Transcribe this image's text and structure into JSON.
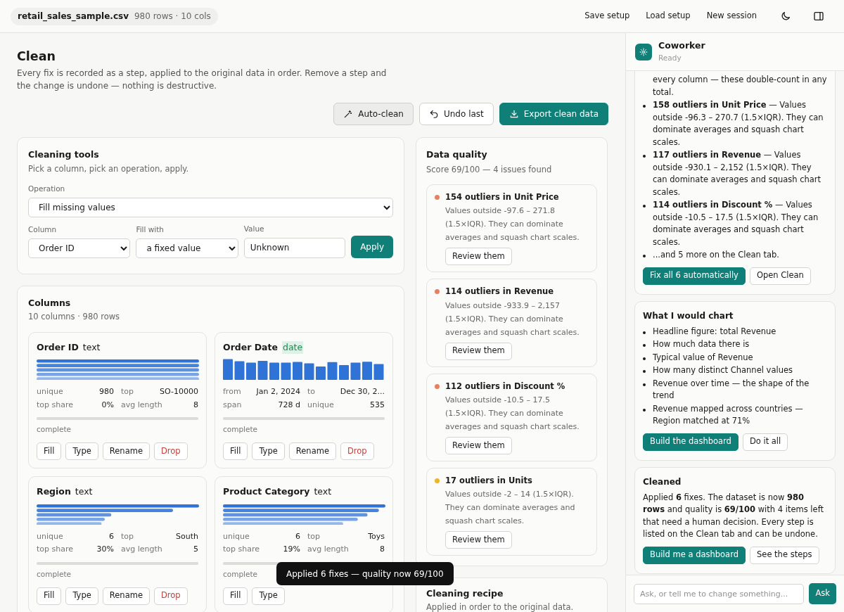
{
  "topbar": {
    "file_name": "retail_sales_sample.csv",
    "file_meta": "980 rows · 10 cols",
    "actions": [
      "Save setup",
      "Load setup",
      "New session"
    ]
  },
  "page": {
    "title": "Clean",
    "description": "Every fix is recorded as a step, applied to the original data in order. Remove a step and the change is undone — nothing is destructive.",
    "actions": [
      {
        "label": "Auto-clean",
        "kind": "auto"
      },
      {
        "label": "Undo last",
        "kind": "undo"
      },
      {
        "label": "Export clean data",
        "kind": "export"
      }
    ]
  },
  "cleaning_tools": {
    "title": "Cleaning tools",
    "subtitle": "Pick a column, pick an operation, apply.",
    "operation": {
      "label": "Operation",
      "value": "Fill missing values"
    },
    "column": {
      "label": "Column",
      "value": "Order ID"
    },
    "fill_with": {
      "label": "Fill with",
      "value": "a fixed value"
    },
    "value": {
      "label": "Value",
      "value": "Unknown"
    },
    "apply": "Apply"
  },
  "columns": {
    "title": "Columns",
    "subtitle": "10 columns · 980 rows",
    "cards": [
      {
        "name": "Order ID",
        "type": "text",
        "stats": [
          {
            "label": "unique",
            "value": "980"
          },
          {
            "label": "top",
            "value": "SO-10000"
          },
          {
            "label": "top share",
            "value": "0%"
          },
          {
            "label": "avg length",
            "value": "8"
          }
        ],
        "completeness": {
          "label": "complete",
          "level": 1
        },
        "actions": [
          {
            "label": "Fill",
            "kind": "plain"
          },
          {
            "label": "Type",
            "kind": "plain"
          },
          {
            "label": "Rename",
            "kind": "plain"
          },
          {
            "label": "Drop",
            "kind": "danger"
          }
        ]
      },
      {
        "name": "Order Date",
        "type": "date",
        "stats": [
          {
            "label": "from",
            "value": "Jan 2, 2024"
          },
          {
            "label": "to",
            "value": "Dec 30, 2..."
          },
          {
            "label": "span",
            "value": "728 d"
          },
          {
            "label": "unique",
            "value": "535"
          }
        ],
        "completeness": {
          "label": "complete",
          "level": 1
        },
        "actions": [
          {
            "label": "Fill",
            "kind": "plain"
          },
          {
            "label": "Type",
            "kind": "plain"
          },
          {
            "label": "Rename",
            "kind": "plain"
          },
          {
            "label": "Drop",
            "kind": "danger"
          }
        ]
      },
      {
        "name": "Region",
        "type": "text",
        "stats": [
          {
            "label": "unique",
            "value": "6"
          },
          {
            "label": "top",
            "value": "South"
          },
          {
            "label": "top share",
            "value": "30%"
          },
          {
            "label": "avg length",
            "value": "5"
          }
        ],
        "completeness": {
          "label": "complete",
          "level": 1
        },
        "actions": [
          {
            "label": "Fill",
            "kind": "plain"
          },
          {
            "label": "Type",
            "kind": "plain"
          },
          {
            "label": "Rename",
            "kind": "plain"
          },
          {
            "label": "Drop",
            "kind": "danger"
          }
        ]
      },
      {
        "name": "Product Category",
        "type": "text",
        "stats": [
          {
            "label": "unique",
            "value": "6"
          },
          {
            "label": "top",
            "value": "Toys"
          },
          {
            "label": "top share",
            "value": "19%"
          },
          {
            "label": "avg length",
            "value": "8"
          }
        ],
        "completeness": {
          "label": "complete",
          "level": 1
        },
        "actions": [
          {
            "label": "Fill",
            "kind": "plain"
          },
          {
            "label": "Type",
            "kind": "plain"
          }
        ]
      }
    ]
  },
  "data_quality": {
    "title": "Data quality",
    "summary": "Score 69/100 — 4 issues found",
    "issues": [
      {
        "title": "154 outliers in Unit Price",
        "detail": "Values outside -97.6 – 271.8 (1.5×IQR). They can dominate averages and squash chart scales.",
        "color": "#e8805f",
        "action": "Review them"
      },
      {
        "title": "114 outliers in Revenue",
        "detail": "Values outside -933.9 – 2,157 (1.5×IQR). They can dominate averages and squash chart scales.",
        "color": "#e8805f",
        "action": "Review them"
      },
      {
        "title": "112 outliers in Discount %",
        "detail": "Values outside -10.5 – 17.5 (1.5×IQR). They can dominate averages and squash chart scales.",
        "color": "#e8805f",
        "action": "Review them"
      },
      {
        "title": "17 outliers in Units",
        "detail": "Values outside -2 – 14 (1.5×IQR). They can dominate averages and squash chart scales.",
        "color": "#f0b429",
        "action": "Review them"
      }
    ]
  },
  "cleaning_recipe": {
    "title": "Cleaning recipe",
    "subtitle": "Applied in order to the original data."
  },
  "toast": "Applied 6 fixes — quality now 69/100",
  "assistant": {
    "name": "Coworker",
    "status": "Ready",
    "messages": [
      {
        "continuation": "every column — these double-count in any total.",
        "items": [
          "**158 outliers in Unit Price** — Values outside -96.3 – 270.7 (1.5×IQR). They can dominate averages and squash chart scales.",
          "**117 outliers in Revenue** — Values outside -930.1 – 2,152 (1.5×IQR). They can dominate averages and squash chart scales.",
          "**114 outliers in Discount %** — Values outside -10.5 – 17.5 (1.5×IQR). They can dominate averages and squash chart scales.",
          "...and 5 more on the Clean tab."
        ],
        "actions": [
          {
            "label": "Fix all 6 automatically",
            "primary": true
          },
          {
            "label": "Open Clean",
            "primary": false
          }
        ]
      },
      {
        "title": "What I would chart",
        "items": [
          "Headline figure: total Revenue",
          "How much data there is",
          "Typical value of Revenue",
          "How many distinct Channel values",
          "Revenue over time — the shape of the trend",
          "Revenue mapped across countries — Region matched at 71%"
        ],
        "actions": [
          {
            "label": "Build the dashboard",
            "primary": true
          },
          {
            "label": "Do it all",
            "primary": false
          }
        ]
      },
      {
        "title": "Cleaned",
        "body": "Applied **6** fixes. The dataset is now **980 rows** and quality is **69/100** with 4 items left that need a human decision. Every step is listed on the Clean tab and can be undone.",
        "actions": [
          {
            "label": "Build me a dashboard",
            "primary": true
          },
          {
            "label": "See the steps",
            "primary": false
          }
        ]
      }
    ],
    "input": {
      "placeholder": "Ask, or tell me to change something..."
    },
    "send": "Ask"
  }
}
